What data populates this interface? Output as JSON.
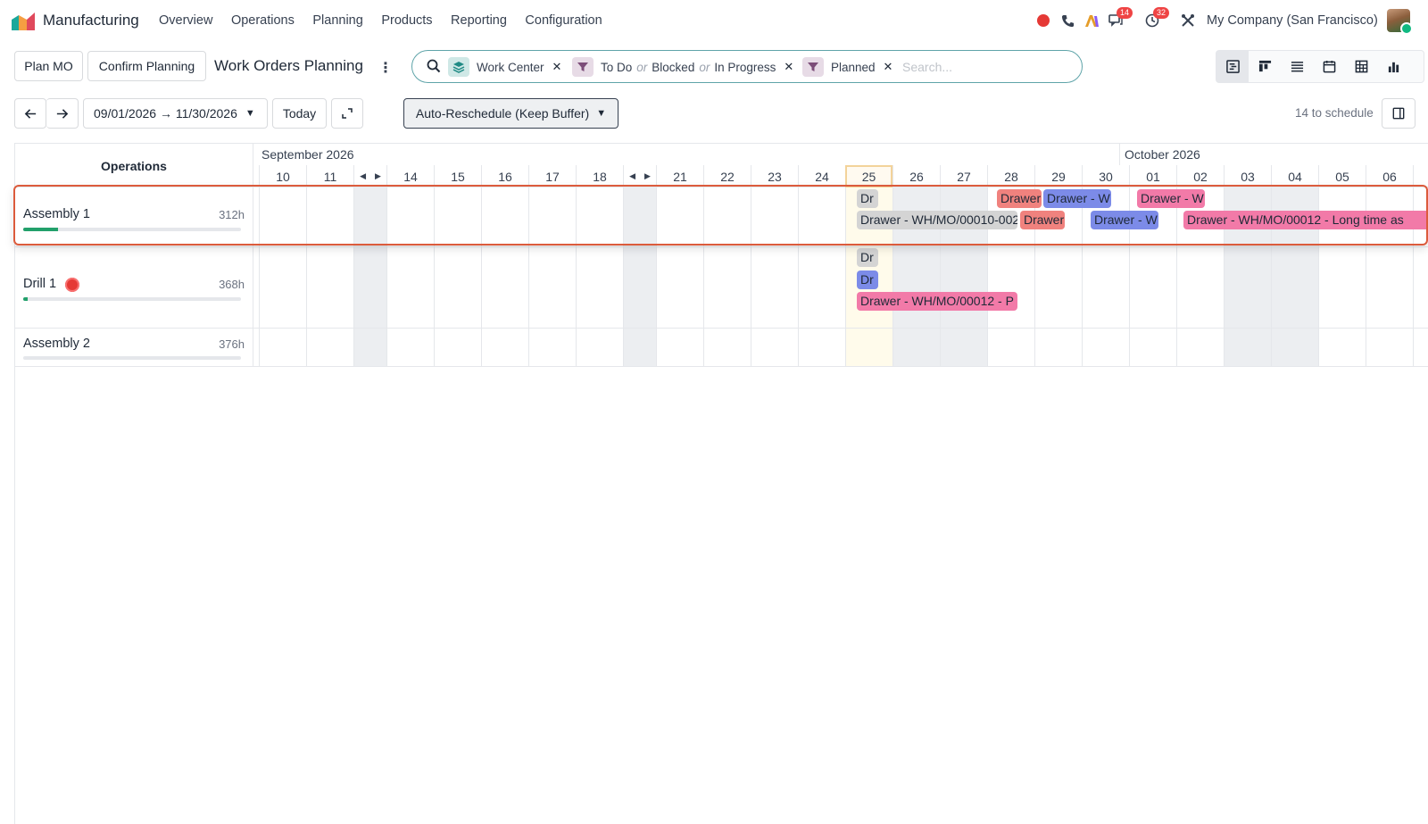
{
  "navbar": {
    "app_name": "Manufacturing",
    "menu": [
      "Overview",
      "Operations",
      "Planning",
      "Products",
      "Reporting",
      "Configuration"
    ],
    "discuss_badge": "14",
    "activity_badge": "32",
    "company": "My Company (San Francisco)"
  },
  "controls": {
    "plan_mo": "Plan MO",
    "confirm_planning": "Confirm Planning",
    "title": "Work Orders Planning",
    "date_range": "09/01/2026 → 11/30/2026",
    "today": "Today",
    "reschedule": "Auto-Reschedule (Keep Buffer)",
    "to_schedule": "14 to schedule"
  },
  "search": {
    "facet_group": "Work Center",
    "facet_state_a": "To Do",
    "facet_state_or1": "or",
    "facet_state_b": "Blocked",
    "facet_state_or2": "or",
    "facet_state_c": "In Progress",
    "facet_planned": "Planned",
    "placeholder": "Search..."
  },
  "gantt": {
    "header": "Operations",
    "months": [
      "September 2026",
      "October 2026"
    ],
    "days": [
      "10",
      "11",
      "14",
      "15",
      "16",
      "17",
      "18",
      "21",
      "22",
      "23",
      "24",
      "25",
      "26",
      "27",
      "28",
      "29",
      "30",
      "01",
      "02",
      "03",
      "04",
      "05",
      "06"
    ],
    "rows": [
      {
        "name": "Assembly 1",
        "hours": "312h",
        "progress": 0.16
      },
      {
        "name": "Drill 1",
        "hours": "368h",
        "progress": 0.02
      },
      {
        "name": "Assembly 2",
        "hours": "376h",
        "progress": 0
      }
    ],
    "pills": {
      "a1_1": "Dr",
      "a1_2": "Drawer",
      "a1_3": "Drawer - W",
      "a1_4": "Drawer - W",
      "a1_5": "Drawer - WH/MO/00010-002",
      "a1_6": "Drawer",
      "a1_7": "Drawer - W",
      "a1_8": "Drawer - WH/MO/00012 - Long time as",
      "d1_1": "Dr",
      "d1_2": "Dr",
      "d1_3": "Drawer - WH/MO/00012 - P"
    }
  }
}
